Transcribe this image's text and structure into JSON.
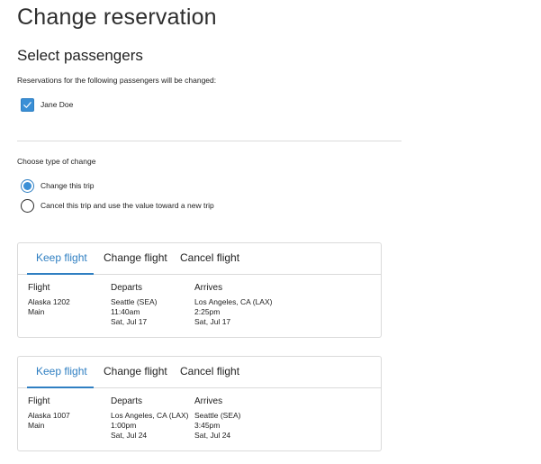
{
  "page": {
    "title": "Change reservation",
    "section_title": "Select passengers",
    "passengers_note": "Reservations for the following passengers will be changed:"
  },
  "passengers": [
    {
      "name": "Jane Doe",
      "checked": true
    }
  ],
  "change_type": {
    "title": "Choose type of change",
    "options": [
      {
        "label": "Change this trip",
        "selected": true
      },
      {
        "label": "Cancel this trip and use the value toward a new trip",
        "selected": false
      }
    ]
  },
  "colors": {
    "accent": "#2f7fc2",
    "checkbox_fill": "#3a8fd6",
    "divider": "#dcdcdc",
    "card_border": "#dadada"
  },
  "flights": [
    {
      "tabs": [
        "Keep flight",
        "Change flight",
        "Cancel flight"
      ],
      "active_tab": "Keep flight",
      "headers": {
        "flight": "Flight",
        "departs": "Departs",
        "arrives": "Arrives"
      },
      "flight": {
        "number": "Alaska 1202",
        "cabin": "Main"
      },
      "departs": {
        "city": "Seattle (SEA)",
        "time": "11:40am",
        "date": "Sat, Jul 17"
      },
      "arrives": {
        "city": "Los Angeles, CA (LAX)",
        "time": "2:25pm",
        "date": "Sat, Jul 17"
      }
    },
    {
      "tabs": [
        "Keep flight",
        "Change flight",
        "Cancel flight"
      ],
      "active_tab": "Keep flight",
      "headers": {
        "flight": "Flight",
        "departs": "Departs",
        "arrives": "Arrives"
      },
      "flight": {
        "number": "Alaska 1007",
        "cabin": "Main"
      },
      "departs": {
        "city": "Los Angeles, CA (LAX)",
        "time": "1:00pm",
        "date": "Sat, Jul 24"
      },
      "arrives": {
        "city": "Seattle (SEA)",
        "time": "3:45pm",
        "date": "Sat, Jul 24"
      }
    }
  ]
}
